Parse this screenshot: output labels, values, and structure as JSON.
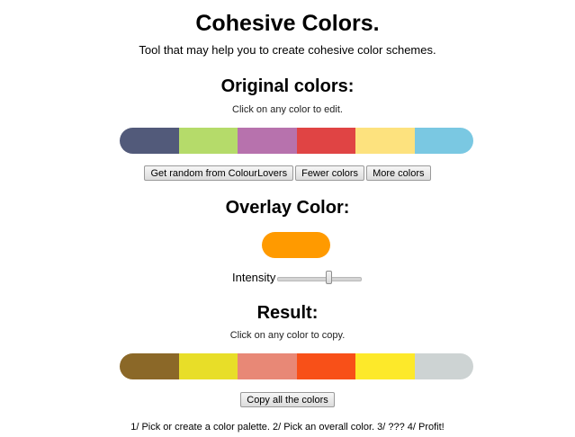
{
  "header": {
    "title": "Cohesive Colors.",
    "subtitle": "Tool that may help you to create cohesive color schemes."
  },
  "original": {
    "heading": "Original colors:",
    "hint": "Click on any color to edit.",
    "colors": [
      "#525a7a",
      "#b5db6a",
      "#b772ad",
      "#e04444",
      "#fde27e",
      "#7ac8e2"
    ],
    "buttons": {
      "random_label": "Get random from ColourLovers",
      "fewer_label": "Fewer colors",
      "more_label": "More colors"
    }
  },
  "overlay": {
    "heading": "Overlay Color:",
    "color": "#ff9a00",
    "intensity_label": "Intensity",
    "intensity_value": 0.64
  },
  "result": {
    "heading": "Result:",
    "hint": "Click on any color to copy.",
    "colors": [
      "#8b6828",
      "#e8de28",
      "#e88876",
      "#f85018",
      "#fde92a",
      "#cdd3d3"
    ],
    "copy_label": "Copy all the colors"
  },
  "footer": {
    "text": "1/ Pick or create a color palette. 2/ Pick an overall color. 3/ ??? 4/ Profit!"
  }
}
